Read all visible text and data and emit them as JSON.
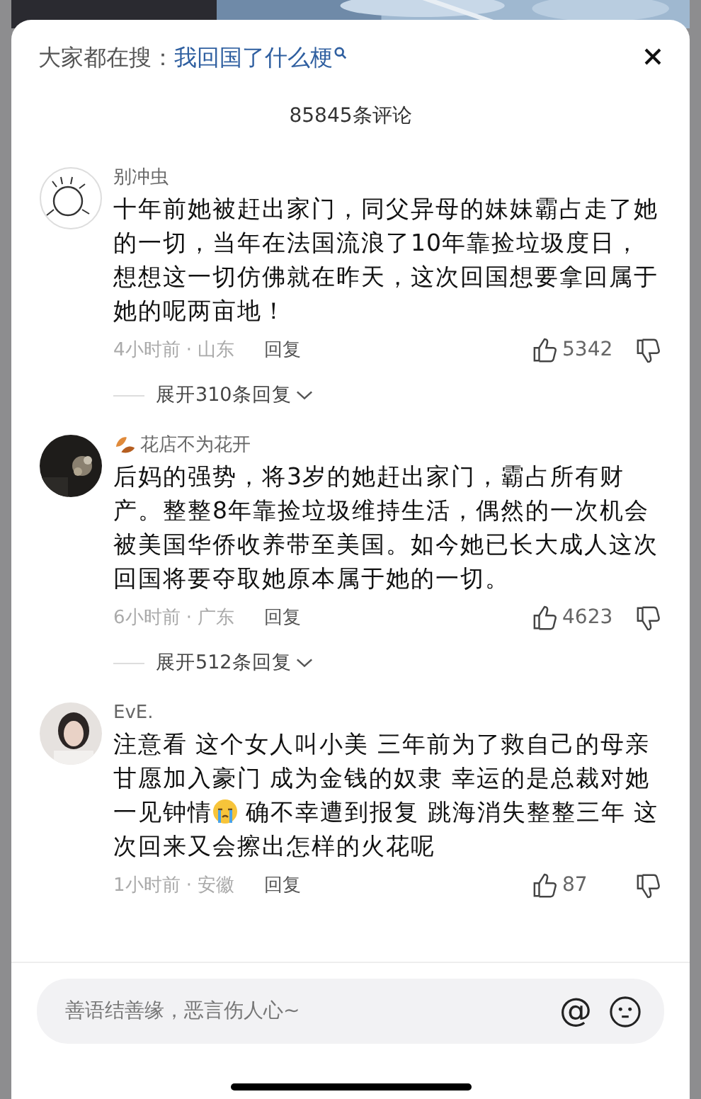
{
  "search_bar": {
    "label": "大家都在搜：",
    "query": "我回国了什么梗"
  },
  "comment_count": "85845条评论",
  "comments": [
    {
      "avatar": {
        "kind": "drawing"
      },
      "username": "别冲虫",
      "badge": false,
      "segments": [
        {
          "kind": "text",
          "text": "十年前她被赶出家门，同父异母的妹妹霸占走了她的一切，当年在法国流浪了10年靠捡垃圾度日，想想这一切仿佛就在昨天，这次回国想要拿回属于她的呢两亩地！"
        }
      ],
      "time_location": "4小时前 · 山东",
      "reply": "回复",
      "likes": "5342",
      "expand": "展开310条回复"
    },
    {
      "avatar": {
        "kind": "dark"
      },
      "username": "花店不为花开",
      "badge": true,
      "segments": [
        {
          "kind": "text",
          "text": "后妈的强势，将3岁的她赶出家门，霸占所有财产。整整8年靠捡垃圾维持生活，偶然的一次机会被美国华侨收养带至美国。如今她已长大成人这次回国将要夺取她原本属于她的一切。"
        }
      ],
      "time_location": "6小时前 · 广东",
      "reply": "回复",
      "likes": "4623",
      "expand": "展开512条回复"
    },
    {
      "avatar": {
        "kind": "light"
      },
      "username": "EvE.",
      "badge": false,
      "segments": [
        {
          "kind": "text",
          "text": "注意看 这个女人叫小美 三年前为了救自己的母亲甘愿加入豪门 成为金钱的奴隶 幸运的是总裁对她一见钟情"
        },
        {
          "kind": "emoji"
        },
        {
          "kind": "text",
          "text": " 确不幸遭到报复 跳海消失整整三年 这次回来又会擦出怎样的火花呢"
        }
      ],
      "time_location": "1小时前 · 安徽",
      "reply": "回复",
      "likes": "87"
    }
  ],
  "input": {
    "placeholder": "善语结善缘，恶言伤人心~",
    "mention": "@"
  }
}
